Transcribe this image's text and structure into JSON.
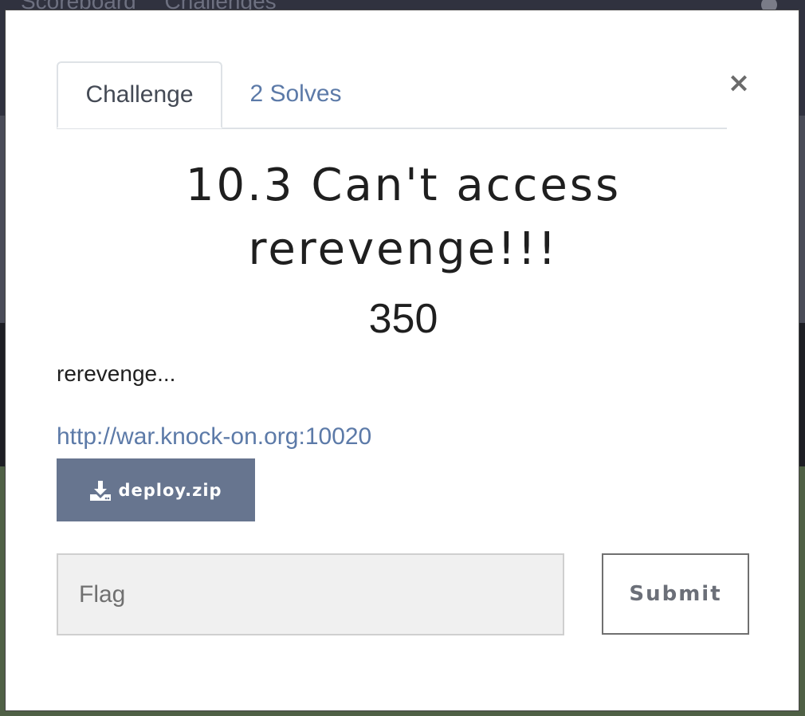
{
  "background": {
    "nav_links": [
      "Scoreboard",
      "Challenges"
    ]
  },
  "modal": {
    "close_label": "×",
    "tabs": [
      {
        "label": "Challenge",
        "active": true
      },
      {
        "label": "2 Solves",
        "active": false
      }
    ],
    "challenge": {
      "title": "10.3 Can't access rerevenge!!!",
      "points": "350",
      "description": "rerevenge...",
      "link": "http://war.knock-on.org:10020",
      "file_label": "deploy.zip",
      "file_icon": "download-icon"
    },
    "flag_input": {
      "value": "",
      "placeholder": "Flag"
    },
    "submit_label": "Submit"
  },
  "colors": {
    "accent": "#5c7aa8",
    "download_button": "#67758f"
  }
}
